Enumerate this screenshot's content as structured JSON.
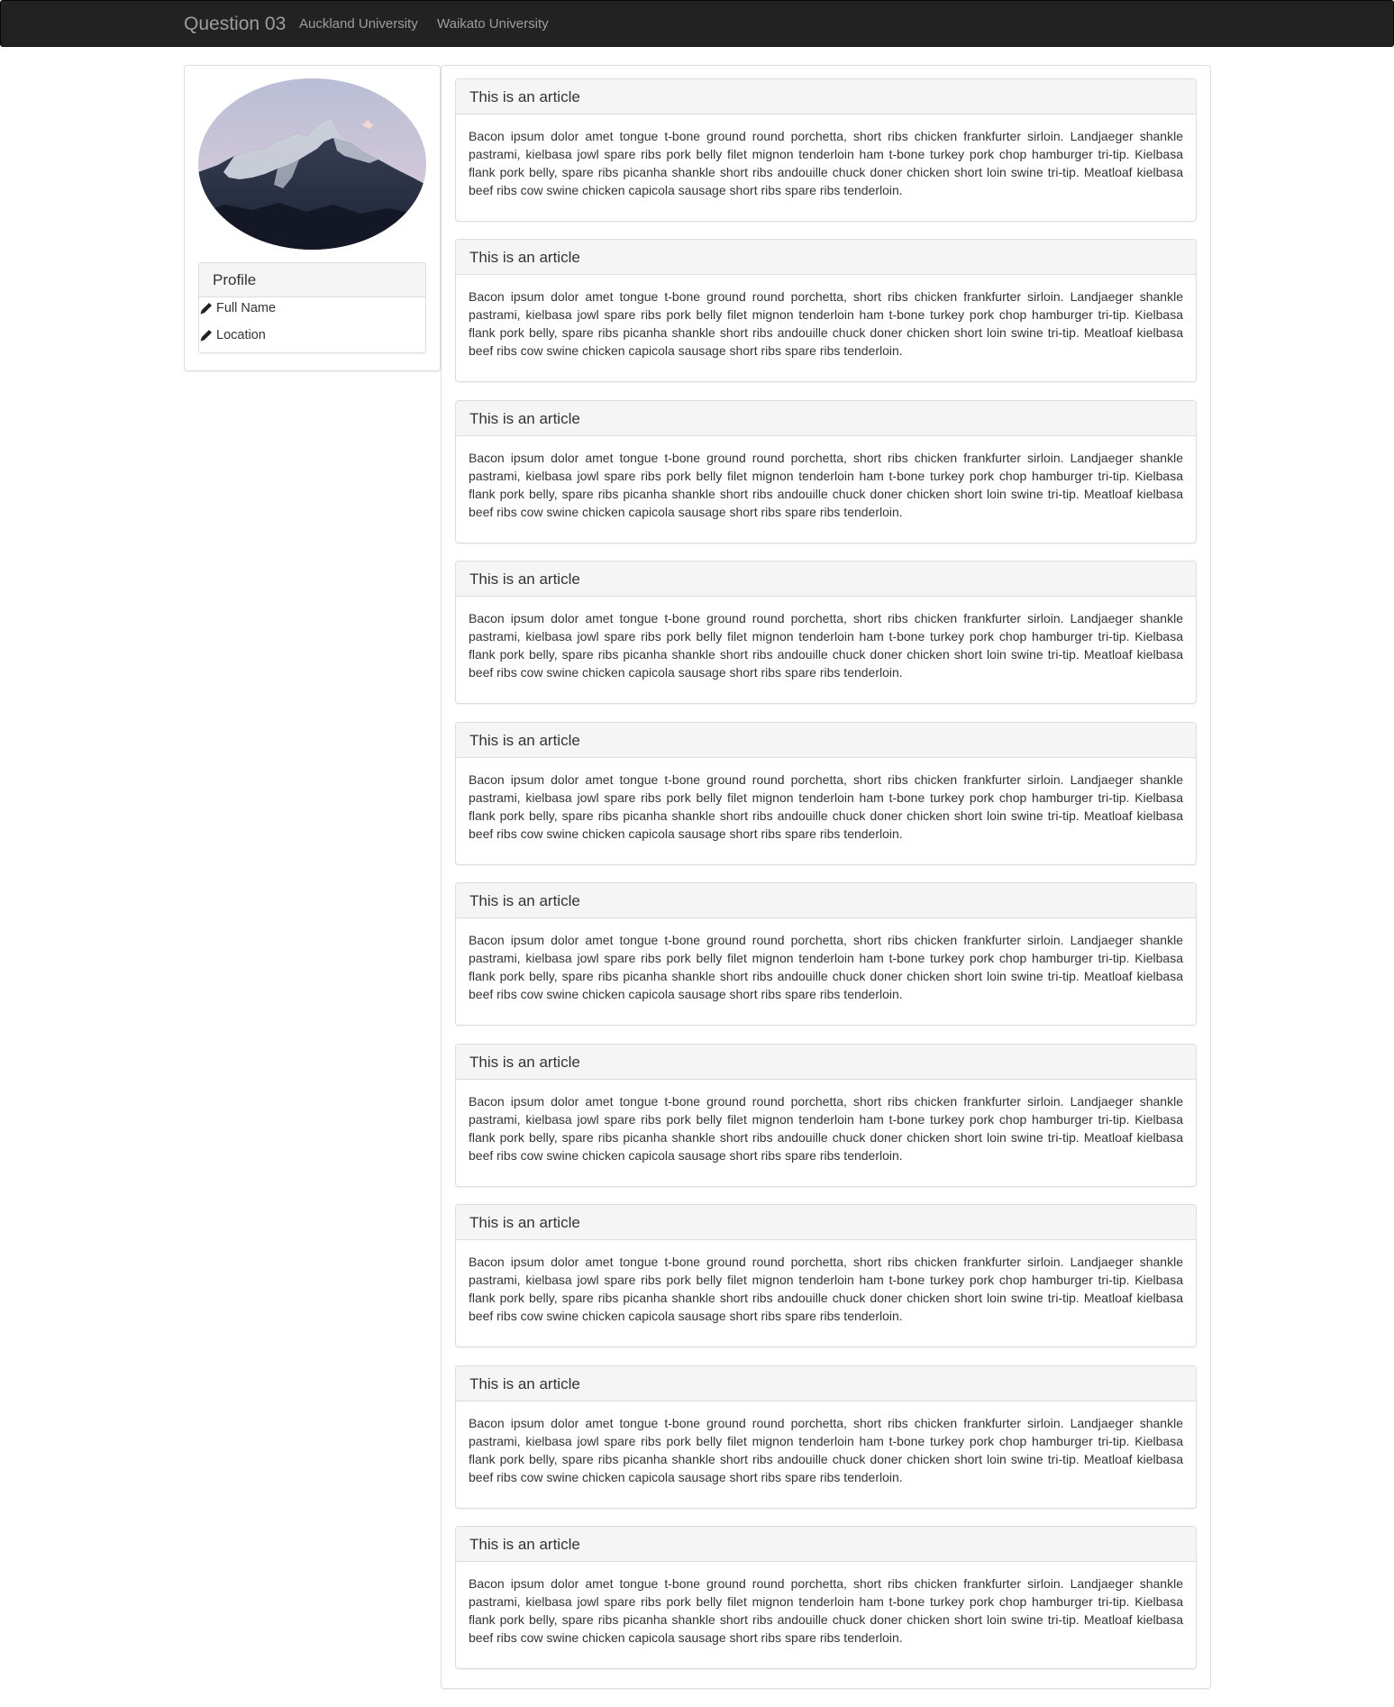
{
  "navbar": {
    "brand": "Question 03",
    "links": [
      "Auckland University",
      "Waikato University"
    ]
  },
  "sidebar": {
    "profile_title": "Profile",
    "items": [
      "Full Name",
      "Location"
    ]
  },
  "articles": [
    {
      "title": "This is an article",
      "body": "Bacon ipsum dolor amet tongue t-bone ground round porchetta, short ribs chicken frankfurter sirloin. Landjaeger shankle pastrami, kielbasa jowl spare ribs pork belly filet mignon tenderloin ham t-bone turkey pork chop hamburger tri-tip. Kielbasa flank pork belly, spare ribs picanha shankle short ribs andouille chuck doner chicken short loin swine tri-tip. Meatloaf kielbasa beef ribs cow swine chicken capicola sausage short ribs spare ribs tenderloin."
    },
    {
      "title": "This is an article",
      "body": "Bacon ipsum dolor amet tongue t-bone ground round porchetta, short ribs chicken frankfurter sirloin. Landjaeger shankle pastrami, kielbasa jowl spare ribs pork belly filet mignon tenderloin ham t-bone turkey pork chop hamburger tri-tip. Kielbasa flank pork belly, spare ribs picanha shankle short ribs andouille chuck doner chicken short loin swine tri-tip. Meatloaf kielbasa beef ribs cow swine chicken capicola sausage short ribs spare ribs tenderloin."
    },
    {
      "title": "This is an article",
      "body": "Bacon ipsum dolor amet tongue t-bone ground round porchetta, short ribs chicken frankfurter sirloin. Landjaeger shankle pastrami, kielbasa jowl spare ribs pork belly filet mignon tenderloin ham t-bone turkey pork chop hamburger tri-tip. Kielbasa flank pork belly, spare ribs picanha shankle short ribs andouille chuck doner chicken short loin swine tri-tip. Meatloaf kielbasa beef ribs cow swine chicken capicola sausage short ribs spare ribs tenderloin."
    },
    {
      "title": "This is an article",
      "body": "Bacon ipsum dolor amet tongue t-bone ground round porchetta, short ribs chicken frankfurter sirloin. Landjaeger shankle pastrami, kielbasa jowl spare ribs pork belly filet mignon tenderloin ham t-bone turkey pork chop hamburger tri-tip. Kielbasa flank pork belly, spare ribs picanha shankle short ribs andouille chuck doner chicken short loin swine tri-tip. Meatloaf kielbasa beef ribs cow swine chicken capicola sausage short ribs spare ribs tenderloin."
    },
    {
      "title": "This is an article",
      "body": "Bacon ipsum dolor amet tongue t-bone ground round porchetta, short ribs chicken frankfurter sirloin. Landjaeger shankle pastrami, kielbasa jowl spare ribs pork belly filet mignon tenderloin ham t-bone turkey pork chop hamburger tri-tip. Kielbasa flank pork belly, spare ribs picanha shankle short ribs andouille chuck doner chicken short loin swine tri-tip. Meatloaf kielbasa beef ribs cow swine chicken capicola sausage short ribs spare ribs tenderloin."
    },
    {
      "title": "This is an article",
      "body": "Bacon ipsum dolor amet tongue t-bone ground round porchetta, short ribs chicken frankfurter sirloin. Landjaeger shankle pastrami, kielbasa jowl spare ribs pork belly filet mignon tenderloin ham t-bone turkey pork chop hamburger tri-tip. Kielbasa flank pork belly, spare ribs picanha shankle short ribs andouille chuck doner chicken short loin swine tri-tip. Meatloaf kielbasa beef ribs cow swine chicken capicola sausage short ribs spare ribs tenderloin."
    },
    {
      "title": "This is an article",
      "body": "Bacon ipsum dolor amet tongue t-bone ground round porchetta, short ribs chicken frankfurter sirloin. Landjaeger shankle pastrami, kielbasa jowl spare ribs pork belly filet mignon tenderloin ham t-bone turkey pork chop hamburger tri-tip. Kielbasa flank pork belly, spare ribs picanha shankle short ribs andouille chuck doner chicken short loin swine tri-tip. Meatloaf kielbasa beef ribs cow swine chicken capicola sausage short ribs spare ribs tenderloin."
    },
    {
      "title": "This is an article",
      "body": "Bacon ipsum dolor amet tongue t-bone ground round porchetta, short ribs chicken frankfurter sirloin. Landjaeger shankle pastrami, kielbasa jowl spare ribs pork belly filet mignon tenderloin ham t-bone turkey pork chop hamburger tri-tip. Kielbasa flank pork belly, spare ribs picanha shankle short ribs andouille chuck doner chicken short loin swine tri-tip. Meatloaf kielbasa beef ribs cow swine chicken capicola sausage short ribs spare ribs tenderloin."
    },
    {
      "title": "This is an article",
      "body": "Bacon ipsum dolor amet tongue t-bone ground round porchetta, short ribs chicken frankfurter sirloin. Landjaeger shankle pastrami, kielbasa jowl spare ribs pork belly filet mignon tenderloin ham t-bone turkey pork chop hamburger tri-tip. Kielbasa flank pork belly, spare ribs picanha shankle short ribs andouille chuck doner chicken short loin swine tri-tip. Meatloaf kielbasa beef ribs cow swine chicken capicola sausage short ribs spare ribs tenderloin."
    },
    {
      "title": "This is an article",
      "body": "Bacon ipsum dolor amet tongue t-bone ground round porchetta, short ribs chicken frankfurter sirloin. Landjaeger shankle pastrami, kielbasa jowl spare ribs pork belly filet mignon tenderloin ham t-bone turkey pork chop hamburger tri-tip. Kielbasa flank pork belly, spare ribs picanha shankle short ribs andouille chuck doner chicken short loin swine tri-tip. Meatloaf kielbasa beef ribs cow swine chicken capicola sausage short ribs spare ribs tenderloin."
    }
  ],
  "icons": {
    "edit": "pencil-icon",
    "avatar": "mountain-photo"
  },
  "colors": {
    "navbar_bg": "#222222",
    "navbar_text": "#9d9d9d",
    "panel_heading_bg": "#f5f5f5",
    "border": "#dddddd",
    "text": "#333333"
  }
}
